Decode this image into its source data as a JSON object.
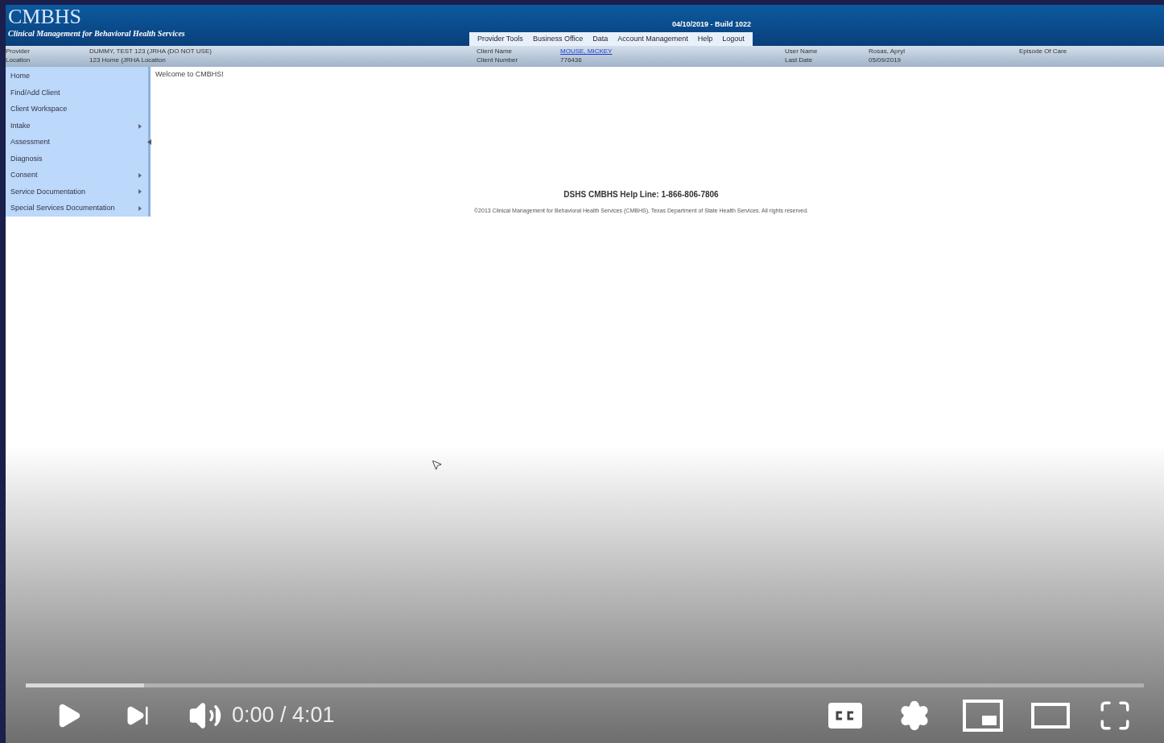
{
  "app": {
    "logo": "CMBHS",
    "subtitle": "Clinical Management for Behavioral Health Services",
    "build": "04/10/2019 - Build 1022"
  },
  "nav": [
    {
      "label": "Provider Tools"
    },
    {
      "label": "Business Office"
    },
    {
      "label": "Data"
    },
    {
      "label": "Account Management"
    },
    {
      "label": "Help"
    },
    {
      "label": "Logout"
    }
  ],
  "info": [
    {
      "label": "Provider",
      "value": "DUMMY, TEST 123 (JRHA (DO NOT USE)",
      "link": false
    },
    {
      "label": "Location",
      "value": "123 Home (JRHA Location",
      "link": false
    },
    {
      "label": "Client Name",
      "value": "MOUSE, MICKEY",
      "link": true
    },
    {
      "label": "Client Number",
      "value": "776436",
      "link": false
    },
    {
      "label": "User Name",
      "value": "Rosas, Apryl",
      "link": false
    },
    {
      "label": "Last Date",
      "value": "05/09/2019",
      "link": false
    },
    {
      "label": "Episode Of Care"
    }
  ],
  "sidebar": {
    "items": [
      {
        "label": "Home",
        "submenu": false
      },
      {
        "label": "Find/Add Client",
        "submenu": false
      },
      {
        "label": "Client Workspace",
        "submenu": false
      },
      {
        "label": "Intake",
        "submenu": true
      },
      {
        "label": "Assessment",
        "submenu": false
      },
      {
        "label": "Diagnosis",
        "submenu": false
      },
      {
        "label": "Consent",
        "submenu": true
      },
      {
        "label": "Service Documentation",
        "submenu": true
      },
      {
        "label": "Special Services Documentation",
        "submenu": true
      }
    ]
  },
  "main": {
    "welcome": "Welcome to CMBHS!",
    "helpline": "DSHS CMBHS Help Line: 1-866-806-7806",
    "copyright": "©2013 Clinical Management for Behavioral Health Services (CMBHS), Texas Department of State Health Services. All rights reserved."
  },
  "player": {
    "level": 0.106,
    "time": "0:00 / 4:01"
  }
}
